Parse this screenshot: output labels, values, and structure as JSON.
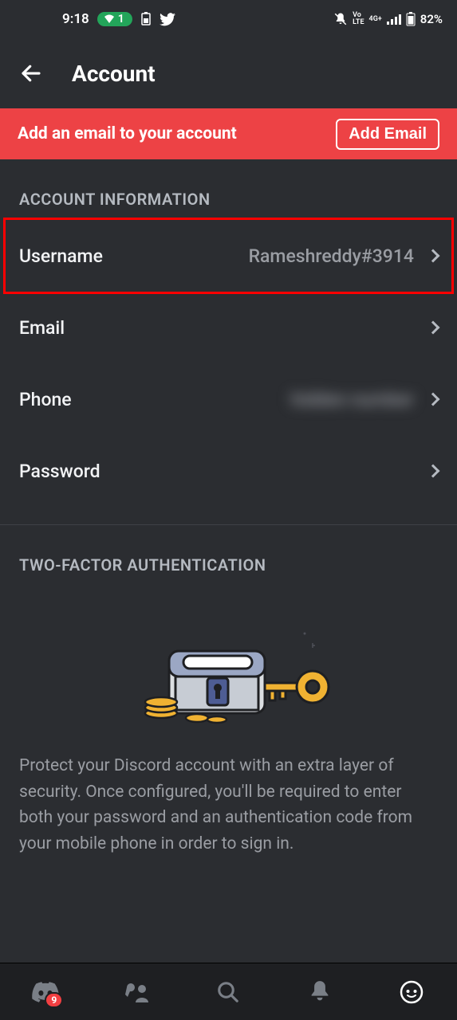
{
  "status": {
    "time": "9:18",
    "wifi_pill": "1",
    "battery": "82%"
  },
  "header": {
    "title": "Account"
  },
  "banner": {
    "text": "Add an email to your account",
    "button": "Add Email"
  },
  "sections": {
    "account_info": "ACCOUNT INFORMATION",
    "twofa": "TWO-FACTOR AUTHENTICATION"
  },
  "rows": {
    "username": {
      "label": "Username",
      "value": "Rameshreddy#3914"
    },
    "email": {
      "label": "Email",
      "value": ""
    },
    "phone": {
      "label": "Phone",
      "value": "hidden number"
    },
    "password": {
      "label": "Password",
      "value": ""
    }
  },
  "twofa_desc": "Protect your Discord account with an extra layer of security. Once configured, you'll be required to enter both your password and an authentication code from your mobile phone in order to sign in.",
  "nav": {
    "badge": "9"
  }
}
